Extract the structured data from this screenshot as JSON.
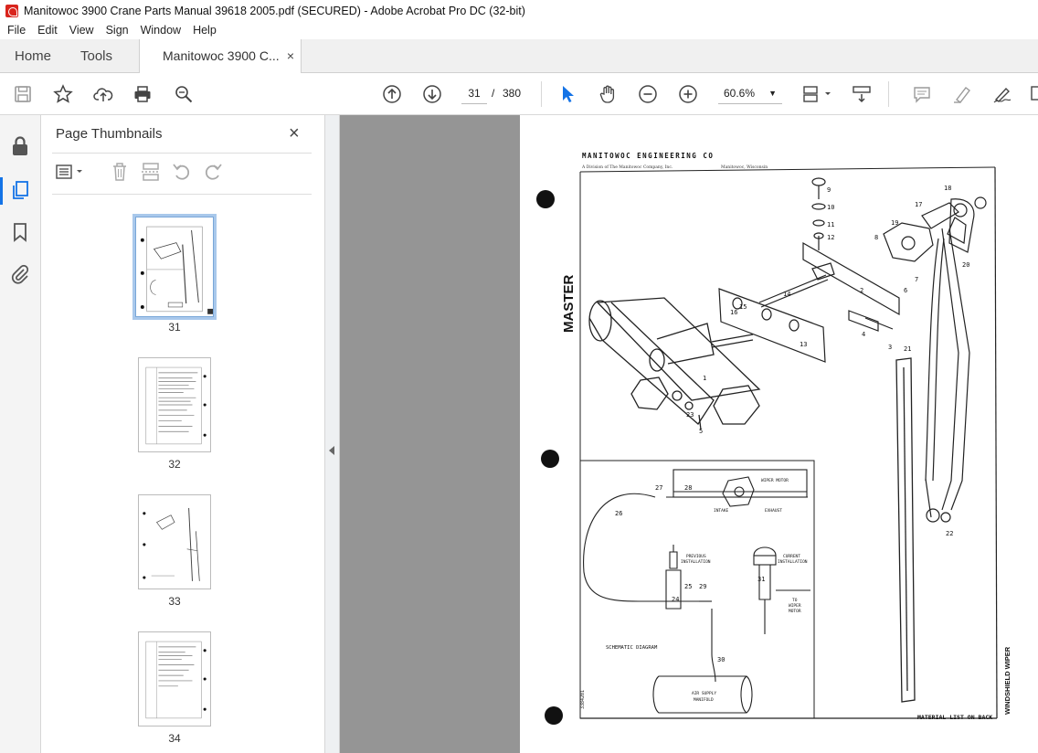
{
  "window": {
    "title": "Manitowoc 3900 Crane Parts Manual 39618 2005.pdf (SECURED) - Adobe Acrobat Pro DC (32-bit)"
  },
  "menu": [
    "File",
    "Edit",
    "View",
    "Sign",
    "Window",
    "Help"
  ],
  "tabs": {
    "home": "Home",
    "tools": "Tools",
    "document": "Manitowoc 3900 C...",
    "close": "×"
  },
  "toolbar": {
    "current_page": "31",
    "separator": "/",
    "total_pages": "380",
    "zoom": "60.6%",
    "icons": [
      "save-icon",
      "bookmark-star-icon",
      "upload-icon",
      "print-icon",
      "zoom-search-icon",
      "page-up-icon",
      "page-down-icon",
      "select-arrow-icon",
      "hand-icon",
      "zoom-out-icon",
      "zoom-in-icon",
      "fit-page-icon",
      "scroll-mode-icon",
      "comment-icon",
      "highlight-icon",
      "sign-icon",
      "more-icon"
    ]
  },
  "left_rail": {
    "icons": [
      "lock-icon",
      "page-thumbnails-icon",
      "bookmarks-icon",
      "attachments-icon"
    ]
  },
  "panel": {
    "title": "Page Thumbnails",
    "close": "×",
    "thumbnails": [
      {
        "number": "31",
        "selected": true
      },
      {
        "number": "32",
        "selected": false
      },
      {
        "number": "33",
        "selected": false
      },
      {
        "number": "34",
        "selected": false
      }
    ]
  },
  "document_page": {
    "header": "MANITOWOC ENGINEERING CO",
    "subheader_left": "A Division of The Manitowoc Company, Inc.",
    "subheader_right": "Manitowoc, Wisconsin",
    "side_label": "MASTER",
    "right_side_label": "WINDSHIELD WIPER",
    "footer": "MATERIAL LIST ON BACK",
    "doc_number": "3384201",
    "schematic_title": "SCHEMATIC DIAGRAM",
    "labels": {
      "wiper_motor": "WIPER MOTOR",
      "intake": "INTAKE",
      "exhaust": "EXHAUST",
      "previous": "PREVIOUS",
      "installation_prev": "INSTALLATION",
      "current": "CURRENT",
      "installation_curr": "INSTALLATION",
      "to_wiper": "TO",
      "to_wiper_2": "WIPER",
      "to_wiper_3": "MOTOR",
      "air_supply": "AIR SUPPLY",
      "manifold": "MANIFOLD"
    },
    "callouts": [
      "1",
      "2",
      "3",
      "4",
      "5",
      "6",
      "7",
      "8",
      "9",
      "10",
      "11",
      "12",
      "13",
      "14",
      "15",
      "16",
      "17",
      "18",
      "19",
      "20",
      "21",
      "22",
      "23",
      "24",
      "25",
      "26",
      "27",
      "28",
      "29",
      "30",
      "31"
    ]
  }
}
